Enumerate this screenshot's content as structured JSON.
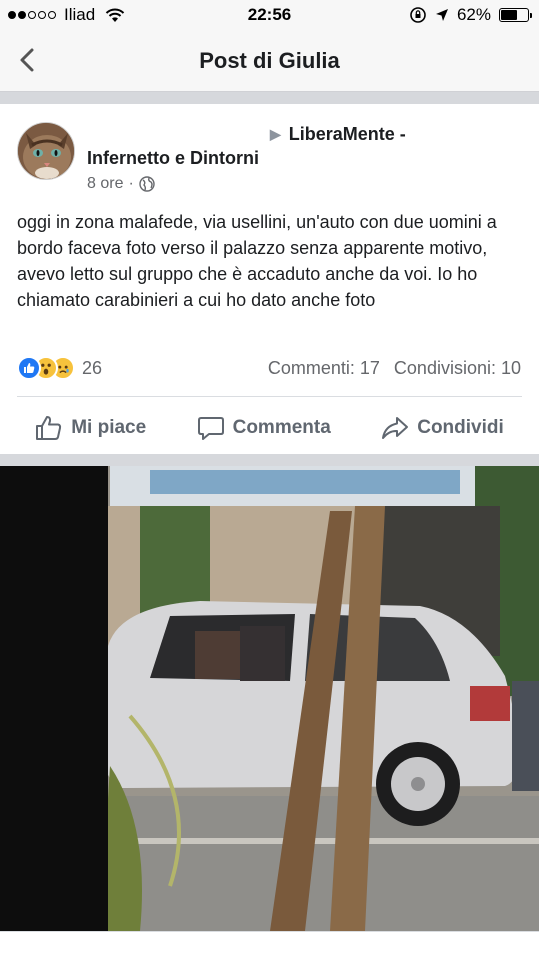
{
  "status_bar": {
    "carrier": "Iliad",
    "time": "22:56",
    "battery_percent": "62%",
    "battery_level": 0.62,
    "signal_bars_filled": 2,
    "signal_bars_total": 5
  },
  "header": {
    "title": "Post di Giulia",
    "back_icon": "chevron-left-icon"
  },
  "post": {
    "group_name_line1": "LiberaMente -",
    "group_name_line2": "Infernetto e Dintorni",
    "time_ago": "8 ore",
    "separator_dot": "·",
    "privacy_icon": "globe-icon",
    "text": "oggi in zona malafede, via usellini, un'auto con due uomini a bordo faceva foto verso il palazzo senza apparente motivo, avevo letto sul gruppo che è accaduto anche da voi. Io ho chiamato carabinieri a cui ho dato anche foto",
    "reaction_count": "26",
    "comments": "Commenti: 17",
    "shares": "Condivisioni: 10"
  },
  "actions": {
    "like": "Mi piace",
    "comment": "Commenta",
    "share": "Condividi"
  },
  "colors": {
    "facebook_blue": "#2078f4",
    "reaction_yellow": "#f7c23c",
    "action_gray": "#606770"
  }
}
